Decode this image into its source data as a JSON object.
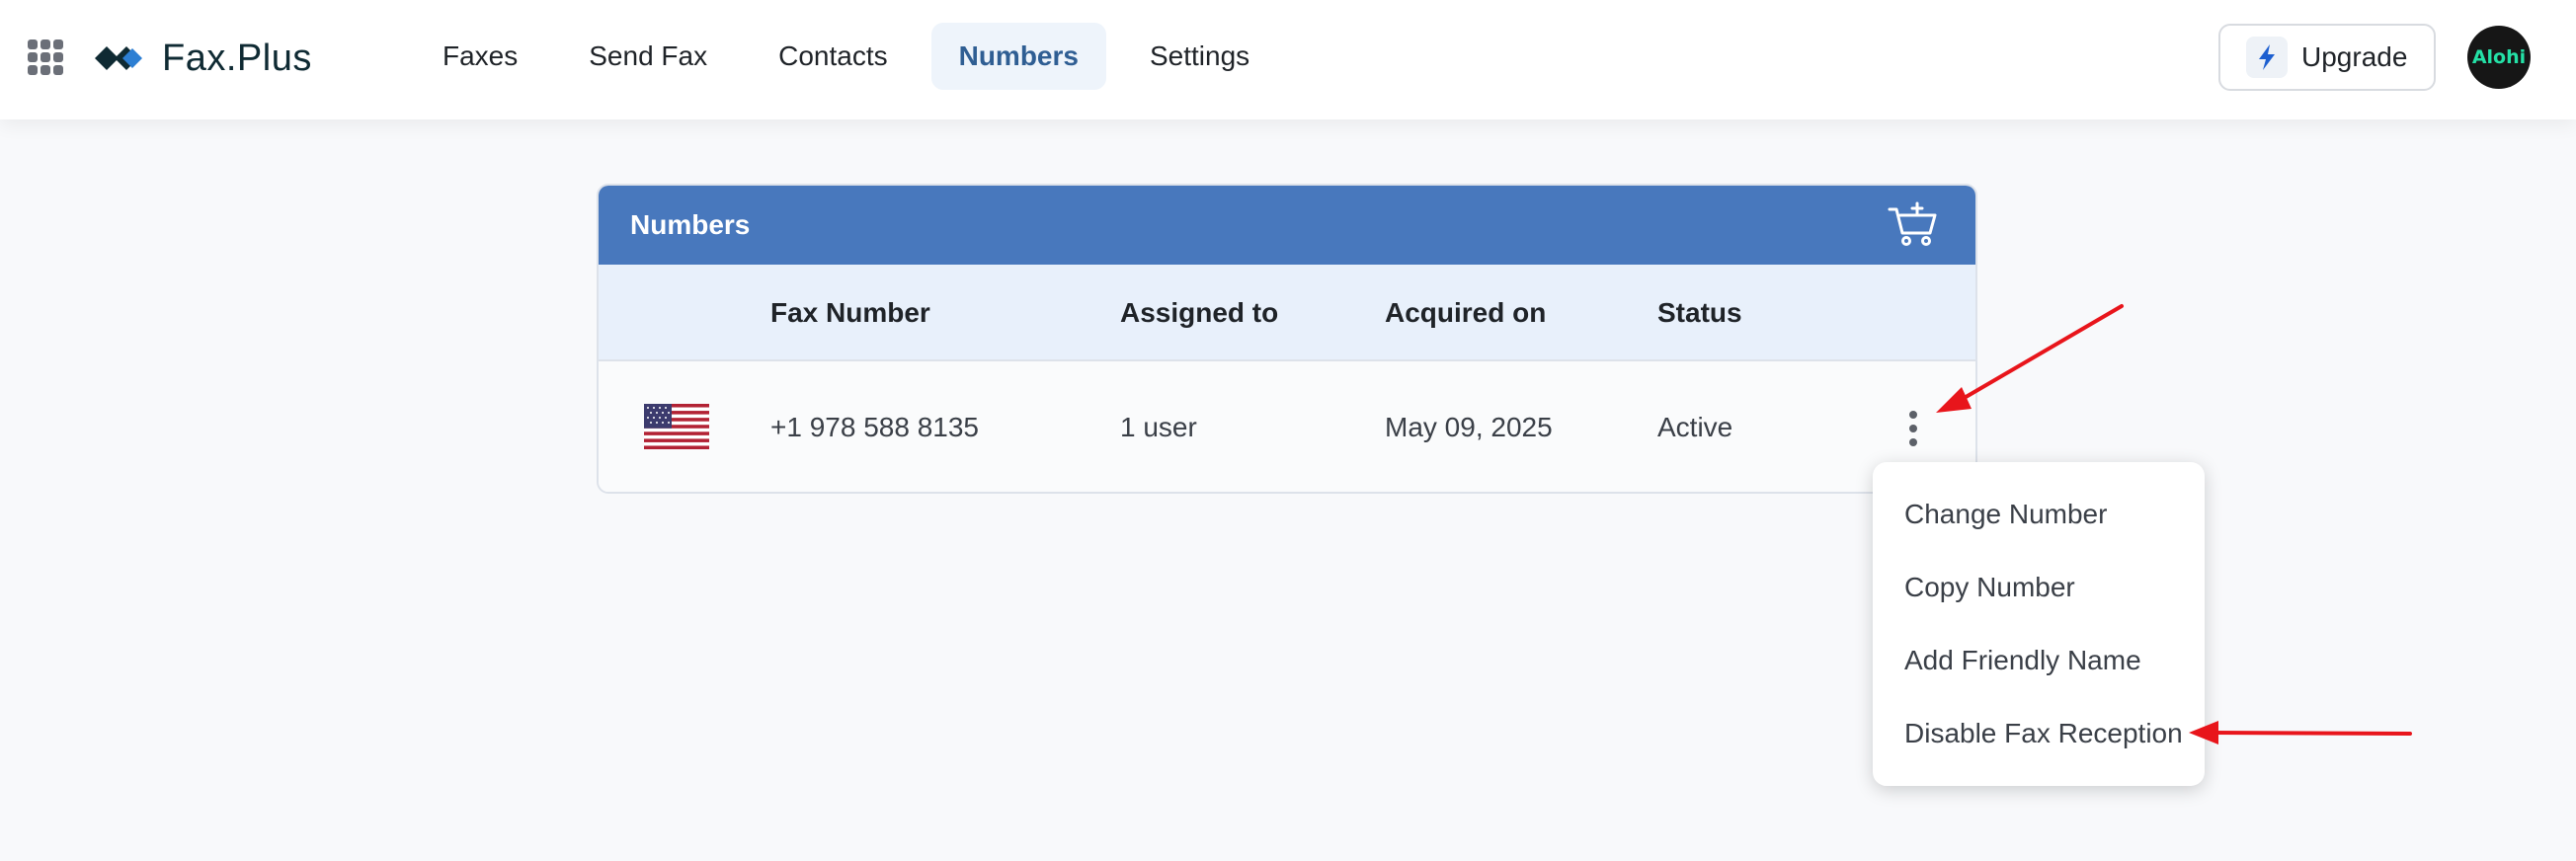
{
  "app": {
    "name": "Fax.Plus"
  },
  "nav": {
    "items": [
      {
        "label": "Faxes"
      },
      {
        "label": "Send Fax"
      },
      {
        "label": "Contacts"
      },
      {
        "label": "Numbers",
        "active": true
      },
      {
        "label": "Settings"
      }
    ]
  },
  "header": {
    "upgrade_label": "Upgrade",
    "avatar_text": "Alohi"
  },
  "numbers_card": {
    "title": "Numbers",
    "columns": [
      "Fax Number",
      "Assigned to",
      "Acquired on",
      "Status"
    ],
    "rows": [
      {
        "country_icon": "us-flag-icon",
        "fax_number": "+1 978 588 8135",
        "assigned_to": "1 user",
        "acquired_on": "May 09, 2025",
        "status": "Active"
      }
    ]
  },
  "row_menu": {
    "items": [
      {
        "label": "Change Number"
      },
      {
        "label": "Copy Number"
      },
      {
        "label": "Add Friendly Name"
      },
      {
        "label": "Disable Fax Reception"
      }
    ]
  },
  "colors": {
    "header_blue": "#4878bd",
    "table_head_bg": "#e8f0fb",
    "nav_active_text": "#2f5e93",
    "annotation_arrow": "#e8151b"
  },
  "icons": [
    "apps-grid-icon",
    "logo-mark-icon",
    "bolt-icon",
    "add-to-cart-icon",
    "us-flag-icon",
    "kebab-menu-icon"
  ]
}
